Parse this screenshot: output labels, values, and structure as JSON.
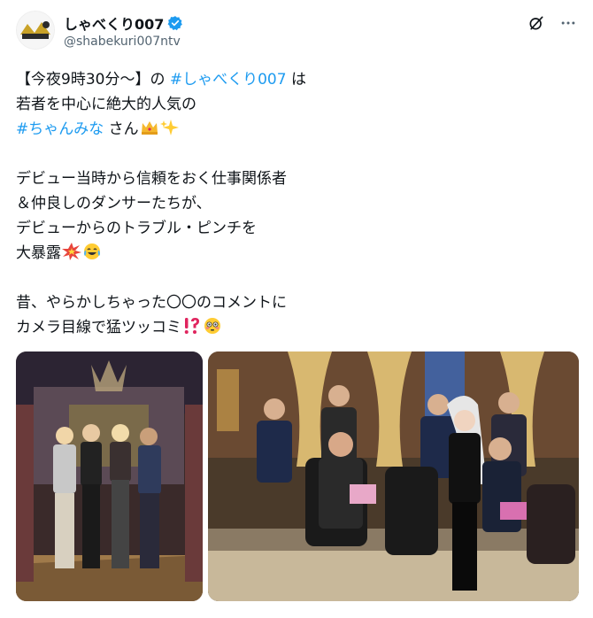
{
  "account": {
    "display_name": "しゃべくり007",
    "handle": "@shabekuri007ntv",
    "avatar_icon": "show-logo-avatar",
    "verified_icon": "verified-badge-icon",
    "verified_color": "#1d9bf0"
  },
  "actions": {
    "grok_icon": "grok-icon",
    "more_icon": "more-dots-icon"
  },
  "post": {
    "l1_a": "【今夜9時30分～】の ",
    "l1_tag": "#しゃべくり007",
    "l1_b": " は",
    "l2": "若者を中心に絶大的人気の",
    "l3_tag": "#ちゃんみな",
    "l3_b": " さん",
    "l3_emoji_1": "crown-emoji",
    "l3_emoji_2": "sparkles-emoji",
    "l4": "デビュー当時から信頼をおく仕事関係者",
    "l5": "＆仲良しのダンサーたちが、",
    "l6": "デビューからのトラブル・ピンチを",
    "l7": "大暴露",
    "l7_emoji_1": "collision-emoji",
    "l7_emoji_2": "tears-of-joy-emoji",
    "l8": "昔、やらかしちゃった〇〇のコメントに",
    "l9": "カメラ目線で猛ツッコミ",
    "l9_emoji_1": "exclamation-question-emoji",
    "l9_emoji_2": "flushed-face-emoji",
    "link_color": "#1d9bf0"
  },
  "media": {
    "photo_1": "group-photo-on-set",
    "photo_2": "studio-talk-scene"
  }
}
